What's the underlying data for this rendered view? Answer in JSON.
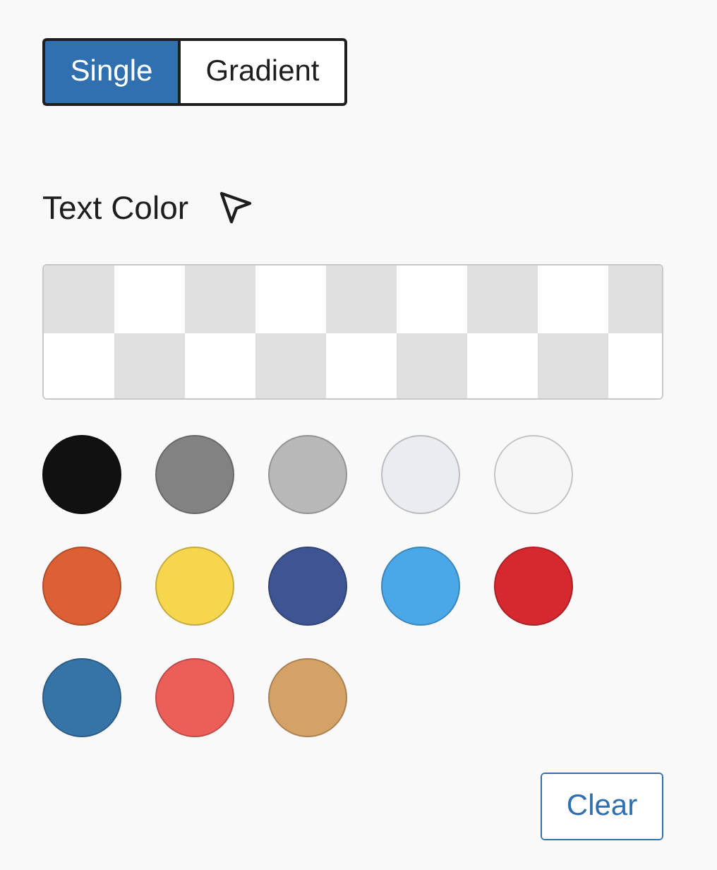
{
  "mode_tabs": [
    {
      "label": "Single",
      "selected": true
    },
    {
      "label": "Gradient",
      "selected": false
    }
  ],
  "heading": "Text Color",
  "swatches": [
    {
      "color": "#111111"
    },
    {
      "color": "#828282"
    },
    {
      "color": "#b8b8b8"
    },
    {
      "color": "#ebecf0"
    },
    {
      "color": "#f6f6f6"
    },
    {
      "color": "#dd5f34"
    },
    {
      "color": "#f5d64c"
    },
    {
      "color": "#3f5593"
    },
    {
      "color": "#4aa8e8"
    },
    {
      "color": "#d6282f"
    },
    {
      "color": "#3674a8"
    },
    {
      "color": "#ec5f59"
    },
    {
      "color": "#d4a267"
    }
  ],
  "clear_button": "Clear"
}
